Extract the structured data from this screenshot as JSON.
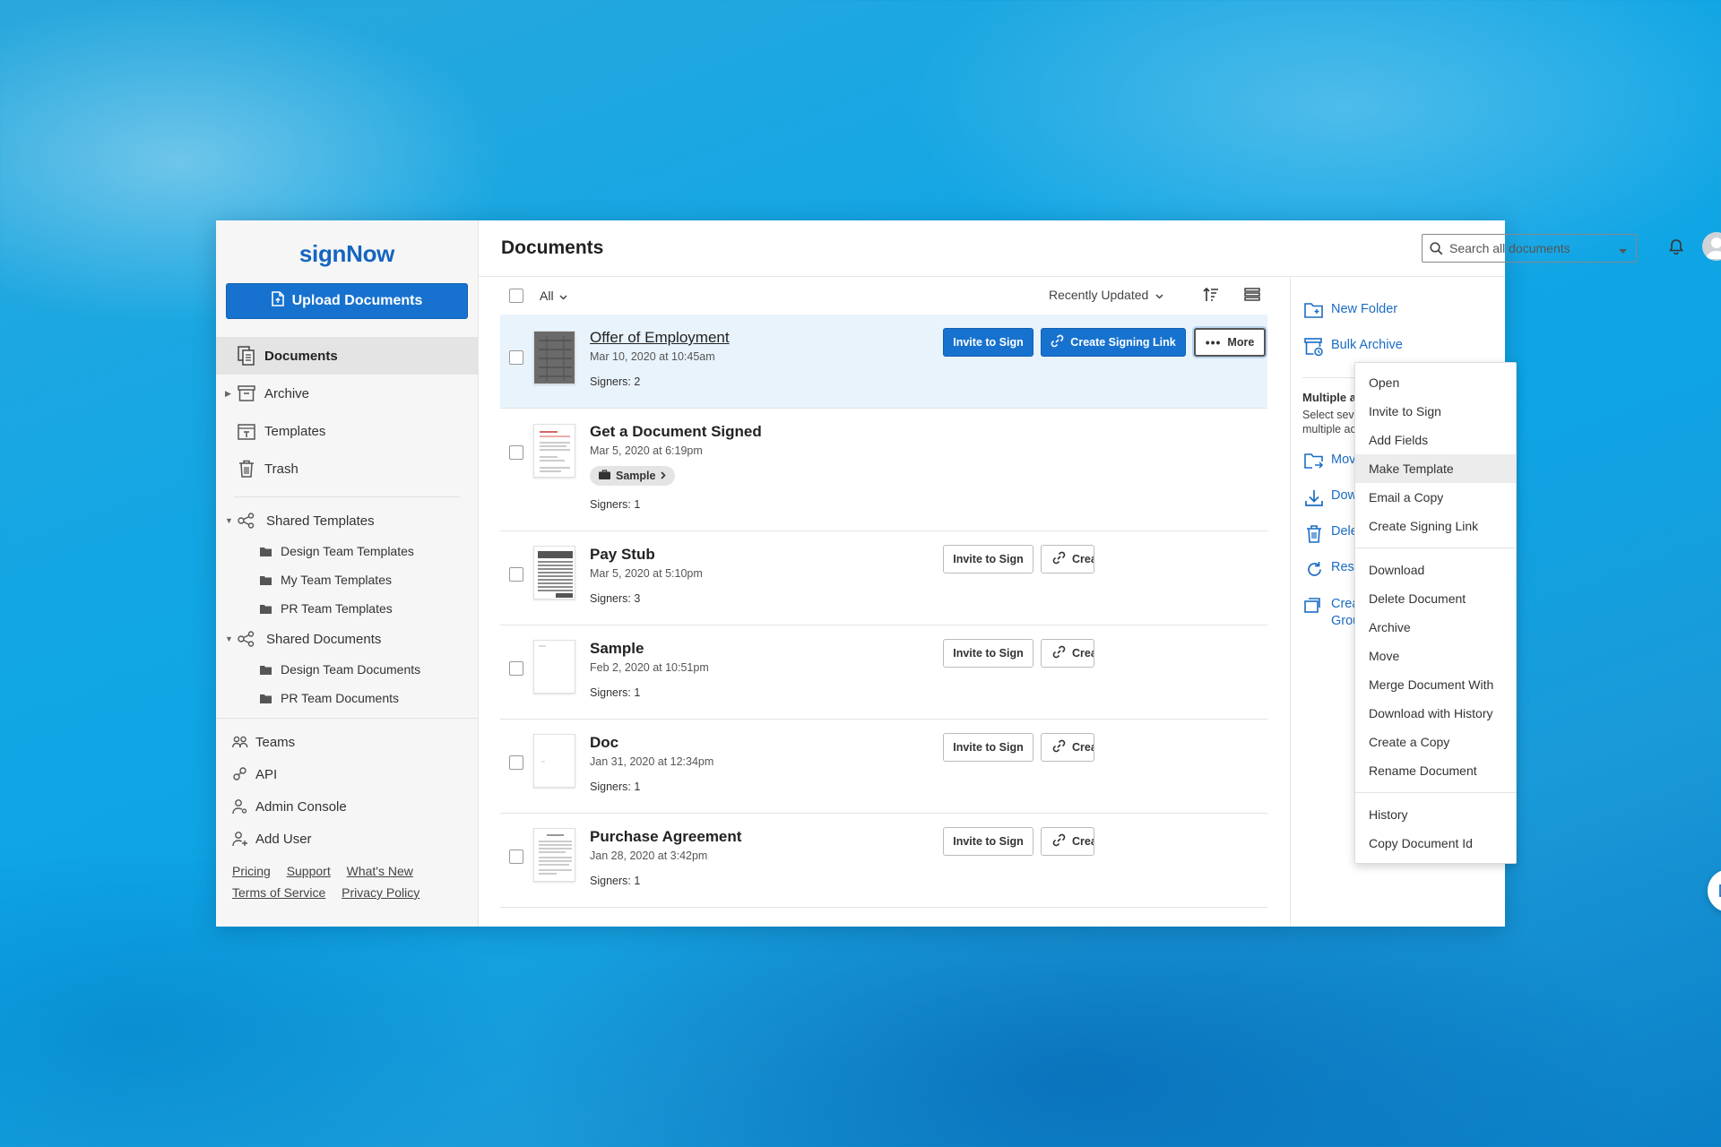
{
  "brand": {
    "logo": "signNow",
    "accent": "#1772cf"
  },
  "sidebar": {
    "upload_label": "Upload Documents",
    "nav": [
      {
        "label": "Documents",
        "icon": "documents-icon",
        "active": true
      },
      {
        "label": "Archive",
        "icon": "archive-icon"
      },
      {
        "label": "Templates",
        "icon": "templates-icon"
      },
      {
        "label": "Trash",
        "icon": "trash-icon"
      }
    ],
    "shared_templates": {
      "label": "Shared Templates",
      "items": [
        "Design Team Templates",
        "My Team Templates",
        "PR Team Templates"
      ]
    },
    "shared_documents": {
      "label": "Shared Documents",
      "items": [
        "Design Team Documents",
        "PR Team Documents"
      ]
    },
    "utilities": [
      {
        "label": "Teams",
        "icon": "teams-icon"
      },
      {
        "label": "API",
        "icon": "api-icon"
      },
      {
        "label": "Admin Console",
        "icon": "admin-icon"
      },
      {
        "label": "Add User",
        "icon": "add-user-icon"
      }
    ],
    "footer": {
      "pricing": "Pricing",
      "support": "Support",
      "whats_new": "What's New",
      "terms": "Terms of Service",
      "privacy": "Privacy Policy"
    }
  },
  "header": {
    "title": "Documents",
    "search_placeholder": "Search all documents"
  },
  "toolbar": {
    "filter": "All",
    "sort": "Recently Updated"
  },
  "documents": [
    {
      "name": "Offer of Employment",
      "date": "Mar 10, 2020 at 10:45am",
      "signers": "Signers: 2"
    },
    {
      "name": "Get a Document Signed",
      "date": "Mar 5, 2020 at 6:19pm",
      "tag": "Sample",
      "signers": "Signers: 1"
    },
    {
      "name": "Pay Stub",
      "date": "Mar 5, 2020 at 5:10pm",
      "signers": "Signers: 3"
    },
    {
      "name": "Sample",
      "date": "Feb 2, 2020 at 10:51pm",
      "signers": "Signers: 1"
    },
    {
      "name": "Doc",
      "date": "Jan 31, 2020 at 12:34pm",
      "signers": "Signers: 1"
    },
    {
      "name": "Purchase Agreement",
      "date": "Jan 28, 2020 at 3:42pm",
      "signers": "Signers: 1"
    }
  ],
  "row_actions": {
    "invite": "Invite to Sign",
    "create_link": "Create Signing Link",
    "create_link_cut": "Creat",
    "more": "More"
  },
  "menu": {
    "group1": [
      "Open",
      "Invite to Sign",
      "Add Fields",
      "Make Template",
      "Email a Copy",
      "Create Signing Link"
    ],
    "group2": [
      "Download",
      "Delete Document",
      "Archive",
      "Move",
      "Merge Document With",
      "Download with History",
      "Create a Copy",
      "Rename Document"
    ],
    "group3": [
      "History",
      "Copy Document Id"
    ],
    "highlighted": "Make Template"
  },
  "right_panel": {
    "new_folder": "New Folder",
    "bulk_archive": "Bulk Archive",
    "multi_heading": "Multiple actions",
    "multi_desc": "Select several documents to use multiple actions",
    "actions": [
      "Move",
      "Download",
      "Delete Documents",
      "Resend Invites",
      "Create Document Group"
    ]
  }
}
